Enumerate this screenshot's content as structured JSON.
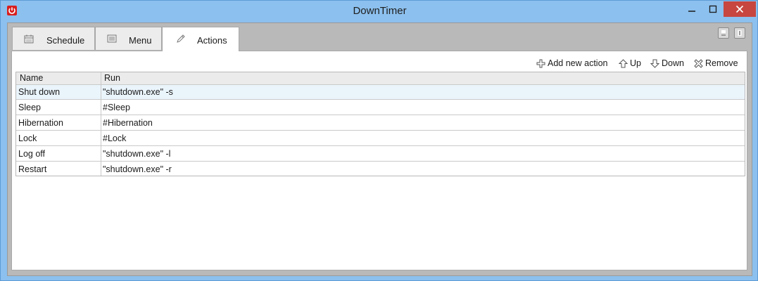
{
  "window": {
    "title": "DownTimer",
    "accent": "#8cc0ee",
    "close_color": "#c7463f"
  },
  "tabs": [
    {
      "label": "Schedule",
      "icon": "calendar-icon",
      "active": false
    },
    {
      "label": "Menu",
      "icon": "menu-list-icon",
      "active": false
    },
    {
      "label": "Actions",
      "icon": "pen-icon",
      "active": true
    }
  ],
  "toolbar": {
    "add_label": "Add new action",
    "up_label": "Up",
    "down_label": "Down",
    "remove_label": "Remove"
  },
  "table": {
    "columns": [
      "Name",
      "Run"
    ],
    "rows": [
      {
        "name": "Shut down",
        "run": "\"shutdown.exe\" -s",
        "selected": true
      },
      {
        "name": "Sleep",
        "run": "#Sleep",
        "selected": false
      },
      {
        "name": "Hibernation",
        "run": "#Hibernation",
        "selected": false
      },
      {
        "name": "Lock",
        "run": "#Lock",
        "selected": false
      },
      {
        "name": "Log off",
        "run": "\"shutdown.exe\" -l",
        "selected": false
      },
      {
        "name": "Restart",
        "run": "\"shutdown.exe\" -r",
        "selected": false
      }
    ]
  }
}
